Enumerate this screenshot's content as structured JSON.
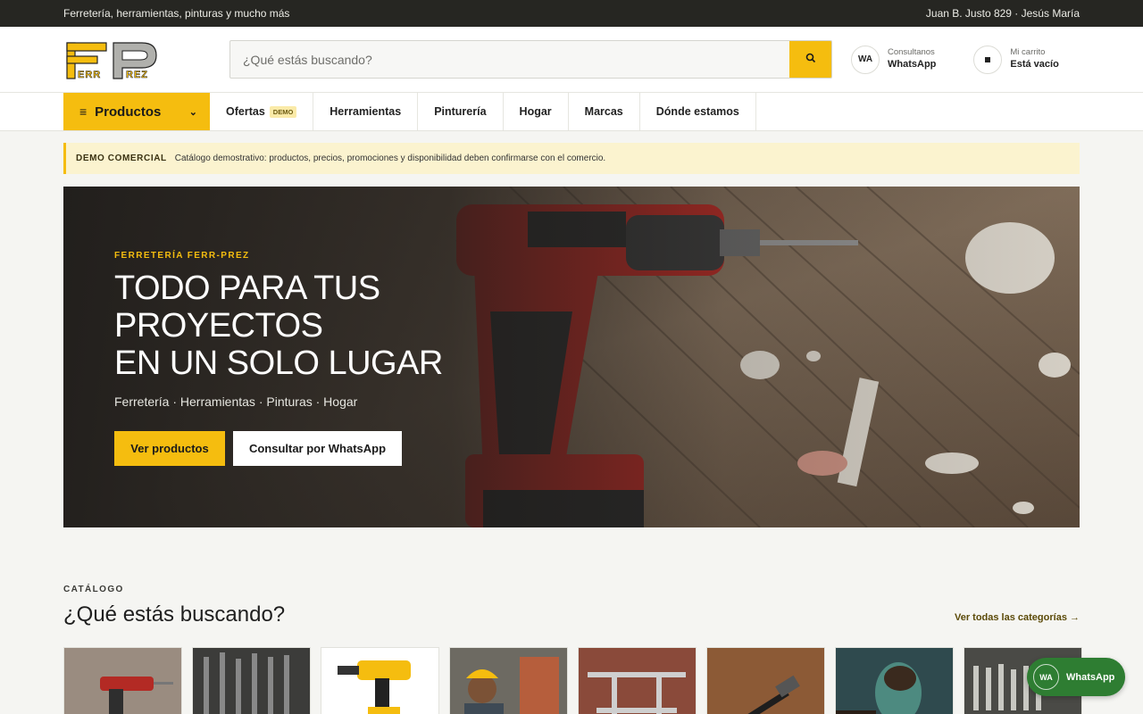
{
  "topbar": {
    "tagline": "Ferretería, herramientas, pinturas y mucho más",
    "address": "Juan B. Justo 829 · Jesús María"
  },
  "brand": {
    "logo_text_top": "FP",
    "logo_text_bottom": "ERRREZ",
    "logo_accent": "#f5bd0f"
  },
  "search": {
    "placeholder": "¿Qué estás buscando?",
    "value": "",
    "icon": "search-icon"
  },
  "contact": {
    "badge": "WA",
    "label": "Consultanos",
    "value": "WhatsApp"
  },
  "cart": {
    "icon": "cart-icon",
    "label": "Mi carrito",
    "value": "Está vacío"
  },
  "nav": {
    "products_label": "Productos",
    "items": [
      {
        "label": "Ofertas",
        "badge": "DEMO"
      },
      {
        "label": "Herramientas"
      },
      {
        "label": "Pinturería"
      },
      {
        "label": "Hogar"
      },
      {
        "label": "Marcas"
      },
      {
        "label": "Dónde estamos"
      }
    ]
  },
  "notice": {
    "tag": "DEMO COMERCIAL",
    "text": "Catálogo demostrativo: productos, precios, promociones y disponibilidad deben confirmarse con el comercio."
  },
  "hero": {
    "eyebrow": "FERRETERÍA FERR-PREZ",
    "title_lines": [
      "TODO PARA TUS",
      "PROYECTOS",
      "EN UN SOLO LUGAR"
    ],
    "subtitle": "Ferretería · Herramientas · Pinturas · Hogar",
    "primary_button": "Ver productos",
    "secondary_button": "Consultar por WhatsApp"
  },
  "catalog": {
    "eyebrow": "CATÁLOGO",
    "title": "¿Qué estás buscando?",
    "link": "Ver todas las categorías →"
  },
  "whatsapp_float": {
    "badge": "WA",
    "label": "WhatsApp"
  },
  "colors": {
    "accent": "#f5bd0f",
    "topbar": "#262622",
    "whatsapp": "#2e7d32"
  }
}
